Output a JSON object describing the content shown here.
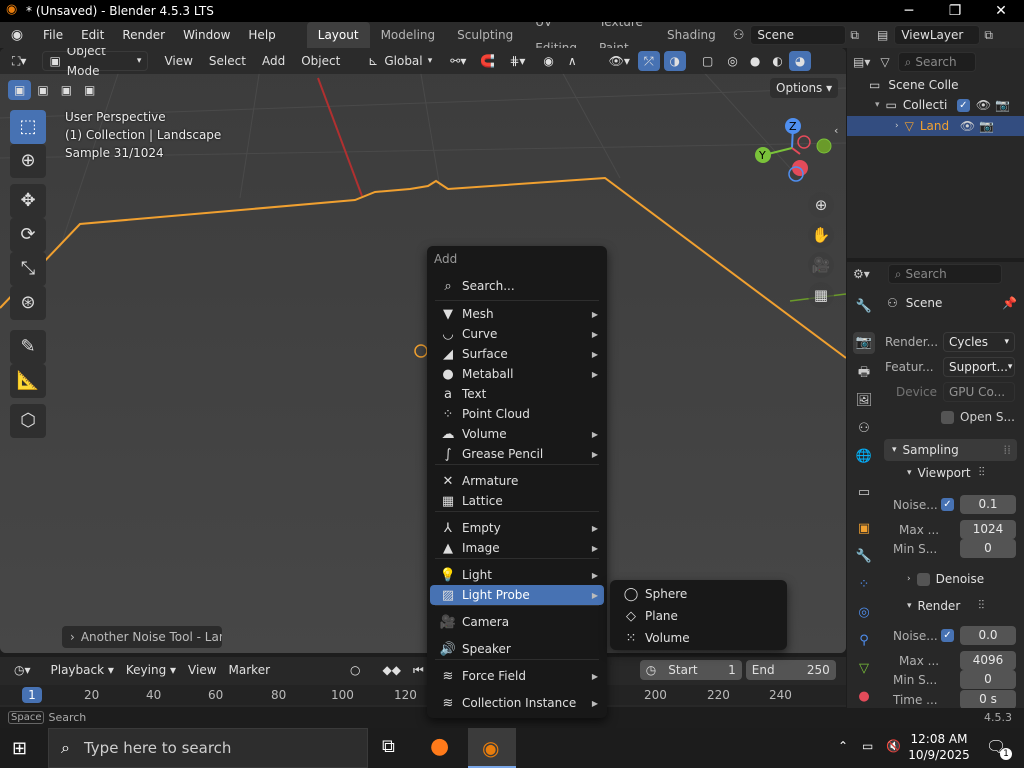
{
  "window": {
    "title": "* (Unsaved) - Blender 4.5.3 LTS",
    "minimize": "─",
    "maximize": "❐",
    "close": "✕"
  },
  "menubar": {
    "items": [
      "File",
      "Edit",
      "Render",
      "Window",
      "Help"
    ],
    "workspaces": [
      "Layout",
      "Modeling",
      "Sculpting",
      "UV Editing",
      "Texture Paint",
      "Shading"
    ],
    "scene": "Scene",
    "viewlayer": "ViewLayer"
  },
  "viewport_header": {
    "mode": "Object Mode",
    "menus": [
      "View",
      "Select",
      "Add",
      "Object"
    ],
    "transform_orientation": "Global",
    "options": "Options"
  },
  "overlay": {
    "line1": "User Perspective",
    "line2": "(1) Collection | Landscape",
    "line3": "Sample 31/1024",
    "operator_panel": "Another Noise Tool - Lan"
  },
  "gizmo": {
    "z": "Z",
    "y": "Y"
  },
  "add_menu": {
    "title": "Add",
    "search": "Search...",
    "items": [
      {
        "label": "Mesh",
        "icon": "▼",
        "sub": true
      },
      {
        "label": "Curve",
        "icon": "◡",
        "sub": true
      },
      {
        "label": "Surface",
        "icon": "◢",
        "sub": true
      },
      {
        "label": "Metaball",
        "icon": "●",
        "sub": true
      },
      {
        "label": "Text",
        "icon": "a",
        "sub": false
      },
      {
        "label": "Point Cloud",
        "icon": "⁘",
        "sub": false
      },
      {
        "label": "Volume",
        "icon": "☁",
        "sub": true
      },
      {
        "label": "Grease Pencil",
        "icon": "∫",
        "sub": true
      },
      {
        "label": "Armature",
        "icon": "✕",
        "sub": false
      },
      {
        "label": "Lattice",
        "icon": "▦",
        "sub": false
      },
      {
        "label": "Empty",
        "icon": "⅄",
        "sub": true
      },
      {
        "label": "Image",
        "icon": "▲",
        "sub": true
      },
      {
        "label": "Light",
        "icon": "💡",
        "sub": true
      },
      {
        "label": "Light Probe",
        "icon": "▨",
        "sub": true
      },
      {
        "label": "Camera",
        "icon": "🎥",
        "sub": false
      },
      {
        "label": "Speaker",
        "icon": "🔊",
        "sub": false
      },
      {
        "label": "Force Field",
        "icon": "≋",
        "sub": true
      },
      {
        "label": "Collection Instance",
        "icon": "≋",
        "sub": true
      }
    ]
  },
  "probe_submenu": {
    "items": [
      "Sphere",
      "Plane",
      "Volume"
    ]
  },
  "outliner": {
    "search": "Search",
    "scene_collection": "Scene Colle",
    "collection": "Collecti",
    "object": "Land"
  },
  "properties": {
    "search": "Search",
    "context": "Scene",
    "render_engine_label": "Render...",
    "render_engine": "Cycles",
    "feature_label": "Featur...",
    "feature": "Support...",
    "device_label": "Device",
    "device": "GPU Co...",
    "open_shading": "Open S...",
    "sampling": "Sampling",
    "viewport": "Viewport",
    "vp_noise_label": "Noise...",
    "vp_noise": "0.1",
    "vp_max_label": "Max ...",
    "vp_max": "1024",
    "vp_min_label": "Min S...",
    "vp_min": "0",
    "denoise": "Denoise",
    "render": "Render",
    "r_noise_label": "Noise...",
    "r_noise": "0.0",
    "r_max_label": "Max ...",
    "r_max": "4096",
    "r_min_label": "Min S...",
    "r_min": "0",
    "r_time_label": "Time ...",
    "r_time": "0 s"
  },
  "timeline": {
    "menus": [
      "Playback",
      "Keying",
      "View",
      "Marker"
    ],
    "start_label": "Start",
    "start": "1",
    "end_label": "End",
    "end": "250",
    "current_frame": "1",
    "ticks": [
      "20",
      "40",
      "60",
      "80",
      "100",
      "120",
      "200",
      "220",
      "240"
    ]
  },
  "statusbar": {
    "key": "Space",
    "action": "Search",
    "version": "4.5.3"
  },
  "taskbar": {
    "search_placeholder": "Type here to search",
    "time": "12:08 AM",
    "date": "10/9/2025",
    "notifications": "1"
  },
  "colors": {
    "accent": "#4772b3",
    "selection_orange": "#f0a030",
    "blender_orange": "#e87d0d"
  }
}
